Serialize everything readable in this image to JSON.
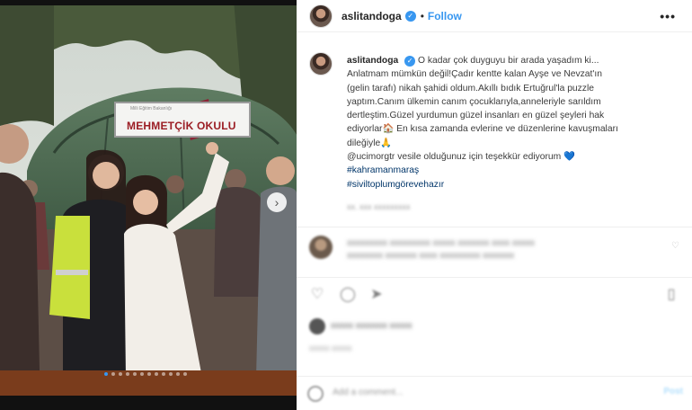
{
  "post": {
    "username": "aslitandoga",
    "verified": true,
    "follow_label": "Follow",
    "more_label": "•••",
    "separator": "•"
  },
  "photo": {
    "sign_small_text": "Milli Eğitim Bakanlığı",
    "sign_main_text": "MEHMETÇİK OKULU",
    "next_arrow": "›",
    "carousel_count": 12,
    "carousel_active_index": 0
  },
  "caption": {
    "username": "aslitandoga",
    "lines": [
      "O kadar çok duyguyu bir arada yaşadım ki...",
      "Anlatmam mümkün değil!Çadır kentte kalan Ayşe ve Nevzat'ın",
      "(gelin tarafı) nikah şahidi oldum.Akıllı bıdık Ertuğrul'la puzzle",
      "yaptım.Canım ülkemin canım çocuklarıyla,anneleriyle sarıldım",
      "dertleştim.Güzel yurdumun güzel insanları en güzel şeyleri hak",
      "ediyorlar🏠 En kısa zamanda evlerine ve düzenlerine kavuşmaları",
      "dileğiyle🙏"
    ],
    "mention_line": "@ucimorgtr vesile olduğunuz için teşekkür ediyorum 💙",
    "hashtags": [
      "#kahramanmaraş",
      "#siviltoplumgörevehazır"
    ]
  },
  "comments": [
    {
      "text": "xxxxxxxxx xxxxxxxxx xxxxx xxxxxxx xxxx xxxxx",
      "line2": "xxxxxxxx xxxxxxx xxxx xxxxxxxxx xxxxxxx"
    },
    {
      "text": ""
    }
  ],
  "likes": {
    "text": "xxxxx xxxxxxx xxxxx"
  },
  "add_comment": {
    "placeholder": "Add a comment...",
    "post_label": "Post"
  },
  "icons": [
    "heart-icon",
    "comment-icon",
    "share-icon",
    "bookmark-icon",
    "emoji-icon"
  ],
  "colors": {
    "accent": "#3897f0",
    "hashtag": "#003569",
    "text": "#262626"
  }
}
